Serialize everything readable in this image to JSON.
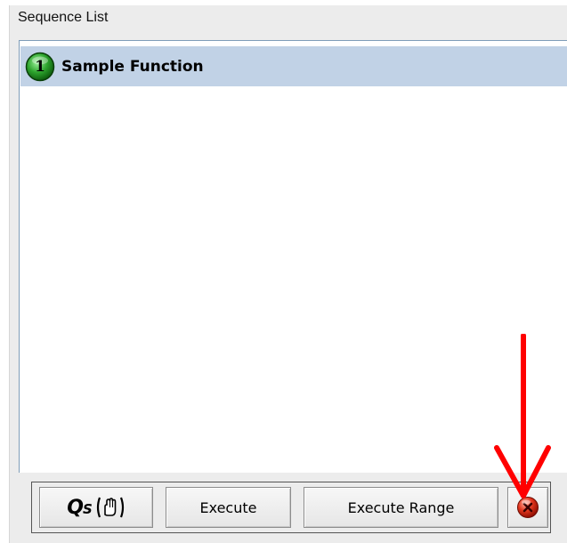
{
  "panel": {
    "title": "Sequence List"
  },
  "sequence_list": {
    "items": [
      {
        "number": "1",
        "label": "Sample Function",
        "status": "active"
      }
    ]
  },
  "toolbar": {
    "qs_label": "Q",
    "qs_sub": "S",
    "execute_label": "Execute",
    "execute_range_label": "Execute Range",
    "stop_icon": "stop-icon"
  },
  "colors": {
    "selection": "#c1d2e6",
    "badge_green": "#2ea52e",
    "stop_red": "#d11a1a",
    "annotation_arrow": "#ff0000"
  }
}
